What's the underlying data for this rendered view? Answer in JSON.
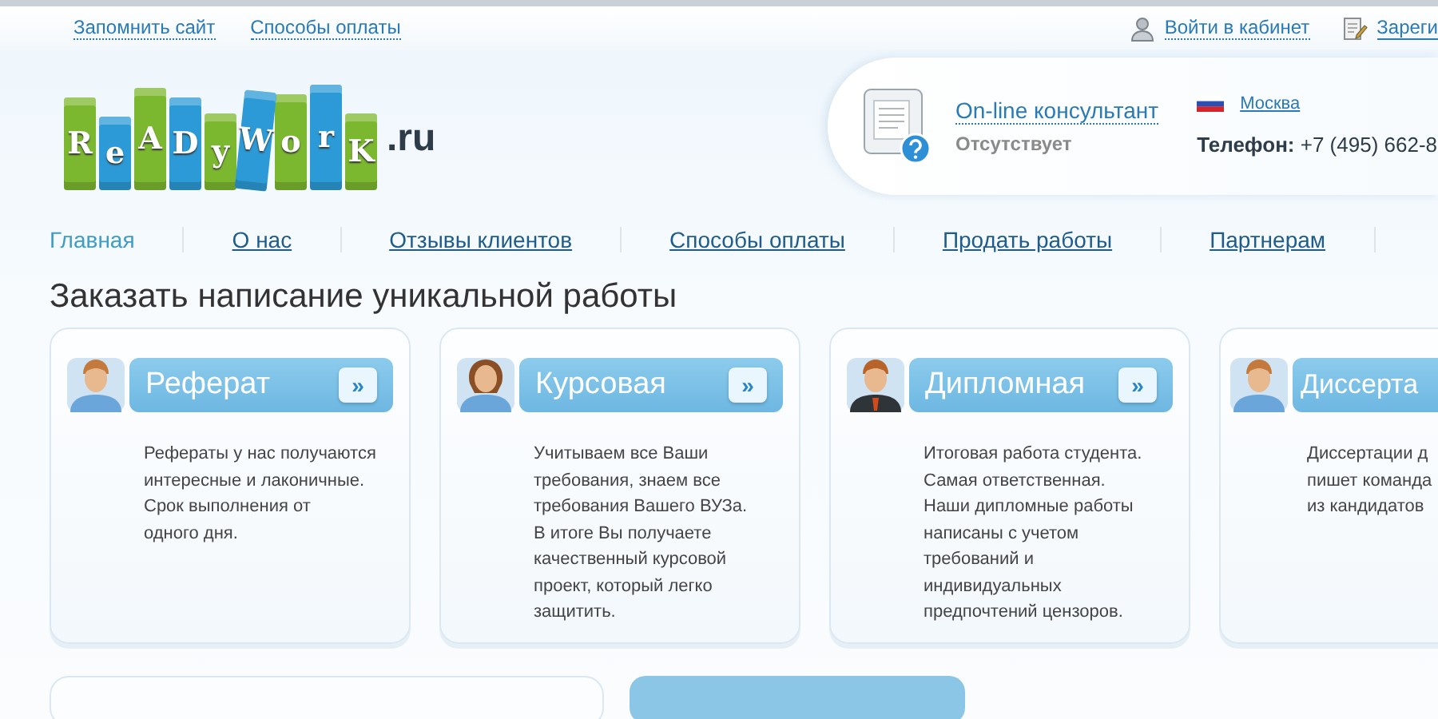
{
  "top_links": [
    {
      "label": "Запомнить сайт"
    },
    {
      "label": "Способы оплаты"
    }
  ],
  "account_links": [
    {
      "label": "Войти в кабинет",
      "kind": "login"
    },
    {
      "label": "Зареги",
      "kind": "register"
    }
  ],
  "logo": {
    "letters": [
      "R",
      "e",
      "A",
      "D",
      "y",
      "W",
      "o",
      "r",
      "K"
    ],
    "domain": ".ru"
  },
  "consultant": {
    "title": "On-line консультант",
    "status": "Отсутствует"
  },
  "contact": {
    "city": "Москва",
    "phone": "**Телефон:** +7 (495) 662-8"
  },
  "nav": [
    {
      "label": "Главная",
      "selected": true
    },
    {
      "label": "О нас",
      "selected": false
    },
    {
      "label": "Отзывы клиентов",
      "selected": false
    },
    {
      "label": "Способы оплаты",
      "selected": false
    },
    {
      "label": "Продать работы",
      "selected": false
    },
    {
      "label": "Партнерам",
      "selected": false
    }
  ],
  "heading": "Заказать написание уникальной работы",
  "cards": [
    {
      "title": "Реферат",
      "kind": "man",
      "button": "»",
      "lines": [
        "Рефераты у нас получаются",
        "интересные и лаконичные.",
        "Срок выполнения от",
        "одного дня."
      ]
    },
    {
      "title": "Курсовая",
      "kind": "woman",
      "button": "»",
      "lines": [
        "Учитываем все Ваши",
        "требования, знаем все",
        "требования Вашего ВУЗа.",
        "В итоге Вы получаете",
        "качественный курсовой",
        "проект, который легко",
        "защитить."
      ]
    },
    {
      "title": "Дипломная",
      "kind": "suit",
      "button": "»",
      "lines": [
        "Итоговая работа студента.",
        "Самая ответственная.",
        "Наши дипломные работы",
        "написаны с учетом",
        "требований и",
        "индивидуальных",
        "предпочтений цензоров."
      ]
    },
    {
      "title": "Диссерта",
      "kind": "man",
      "lines": [
        "Диссертации д",
        "пишет команда",
        "из кандидатов"
      ]
    }
  ]
}
